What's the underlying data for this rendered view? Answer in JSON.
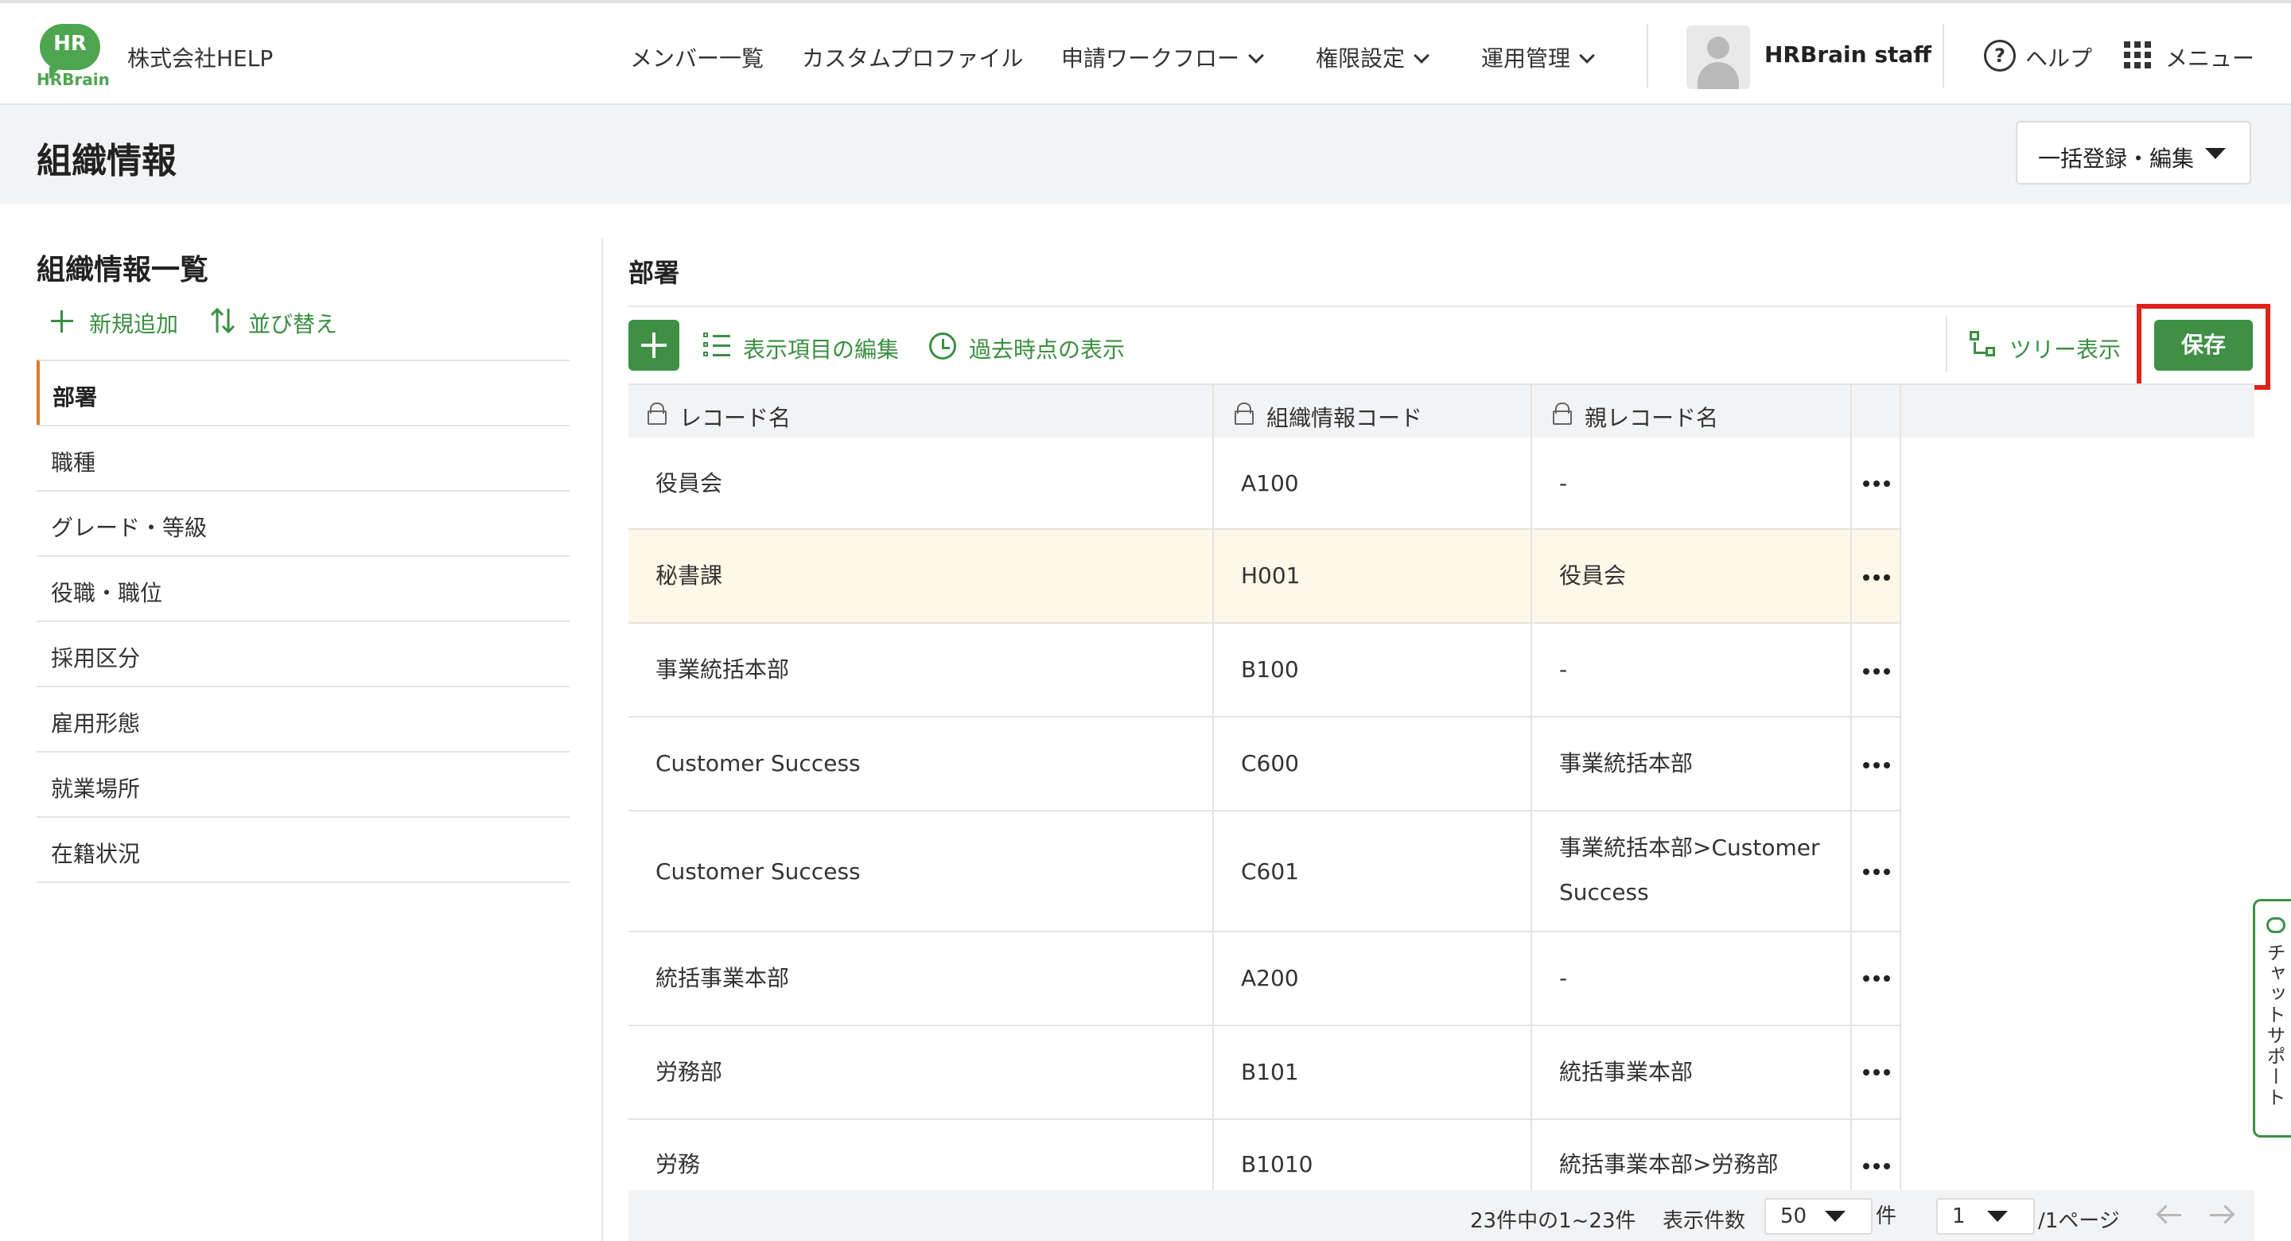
{
  "header": {
    "logo_top": "HR",
    "logo_bottom": "HRBrain",
    "company": "株式会社HELP",
    "nav": [
      {
        "label": "メンバー一覧",
        "dropdown": false
      },
      {
        "label": "カスタムプロファイル",
        "dropdown": false
      },
      {
        "label": "申請ワークフロー",
        "dropdown": true
      },
      {
        "label": "権限設定",
        "dropdown": true
      },
      {
        "label": "運用管理",
        "dropdown": true
      }
    ],
    "user_name": "HRBrain staff",
    "help_label": "ヘルプ",
    "menu_label": "メニュー"
  },
  "page": {
    "title": "組織情報",
    "bulk_button": "一括登録・編集"
  },
  "sidebar": {
    "title": "組織情報一覧",
    "add_label": "新規追加",
    "sort_label": "並び替え",
    "items": [
      {
        "label": "部署",
        "active": true
      },
      {
        "label": "職種",
        "active": false
      },
      {
        "label": "グレード・等級",
        "active": false
      },
      {
        "label": "役職・職位",
        "active": false
      },
      {
        "label": "採用区分",
        "active": false
      },
      {
        "label": "雇用形態",
        "active": false
      },
      {
        "label": "就業場所",
        "active": false
      },
      {
        "label": "在籍状況",
        "active": false
      }
    ]
  },
  "main": {
    "section_title": "部署",
    "toolbar": {
      "edit_columns": "表示項目の編集",
      "past_view": "過去時点の表示",
      "tree_view": "ツリー表示",
      "save": "保存"
    },
    "columns": [
      "レコード名",
      "組織情報コード",
      "親レコード名"
    ],
    "rows": [
      {
        "name": "役員会",
        "code": "A100",
        "parent_lines": [
          "-"
        ],
        "highlighted": false
      },
      {
        "name": "秘書課",
        "code": "H001",
        "parent_lines": [
          "役員会"
        ],
        "highlighted": true
      },
      {
        "name": "事業統括本部",
        "code": "B100",
        "parent_lines": [
          "-"
        ],
        "highlighted": false
      },
      {
        "name": "Customer Success",
        "code": "C600",
        "parent_lines": [
          "事業統括本部"
        ],
        "highlighted": false
      },
      {
        "name": "Customer Success",
        "code": "C601",
        "parent_lines": [
          "事業統括本部>Customer",
          "Success"
        ],
        "highlighted": false
      },
      {
        "name": "統括事業本部",
        "code": "A200",
        "parent_lines": [
          "-"
        ],
        "highlighted": false
      },
      {
        "name": "労務部",
        "code": "B101",
        "parent_lines": [
          "統括事業本部"
        ],
        "highlighted": false
      },
      {
        "name": "労務",
        "code": "B1010",
        "parent_lines": [
          "統括事業本部>労務部"
        ],
        "highlighted": false
      }
    ],
    "footer": {
      "summary": "23件中の1~23件",
      "per_page_label": "表示件数",
      "per_page_value": "50",
      "per_page_unit": "件",
      "page_value": "1",
      "page_total": "/1ページ"
    }
  },
  "chat_support": "チャットサポート",
  "colors": {
    "brand_green": "#3f8f45",
    "accent_orange": "#e07a2f",
    "highlight_red": "#e0231a",
    "row_highlight": "#fdf8e8"
  }
}
